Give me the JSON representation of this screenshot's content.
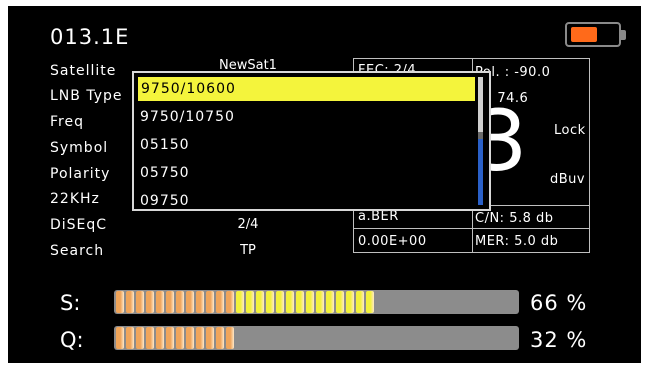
{
  "header": {
    "title": "013.1E"
  },
  "battery": {
    "level": 0.5,
    "color": "#ff6a1a"
  },
  "params": [
    {
      "label": "Satellite",
      "value": "NewSat1"
    },
    {
      "label": "LNB Type",
      "value": ""
    },
    {
      "label": "Freq",
      "value": ""
    },
    {
      "label": "Symbol",
      "value": ""
    },
    {
      "label": "Polarity",
      "value": ""
    },
    {
      "label": "22KHz",
      "value": ""
    },
    {
      "label": "DiSEqC",
      "value": "2/4"
    },
    {
      "label": "Search",
      "value": "TP"
    }
  ],
  "info": {
    "fec": "FEC: 2/4",
    "pol": "Pol. : -90.0",
    "el": "El:  74.6",
    "level_digit": "3",
    "lock": "Lock",
    "unit": "dBuv",
    "ber_label": "a.BER",
    "ber_value": "0.00E+00",
    "cn": "C/N:  5.8 db",
    "mer": "MER: 5.0 db"
  },
  "dropdown": {
    "options": [
      "9750/10600",
      "9750/10750",
      "05150",
      "05750",
      "09750"
    ],
    "selected_index": 0,
    "highlight_color": "#f4f43c"
  },
  "bars": [
    {
      "label": "S:",
      "percent": 66,
      "percent_text": "66 %",
      "orange_fraction": 0.45
    },
    {
      "label": "Q:",
      "percent": 32,
      "percent_text": "32 %",
      "orange_fraction": 1.0
    }
  ],
  "colors": {
    "segment_orange": "#f0a55a",
    "segment_yellow": "#f2f23a",
    "bar_empty": "#8c8c8c"
  }
}
